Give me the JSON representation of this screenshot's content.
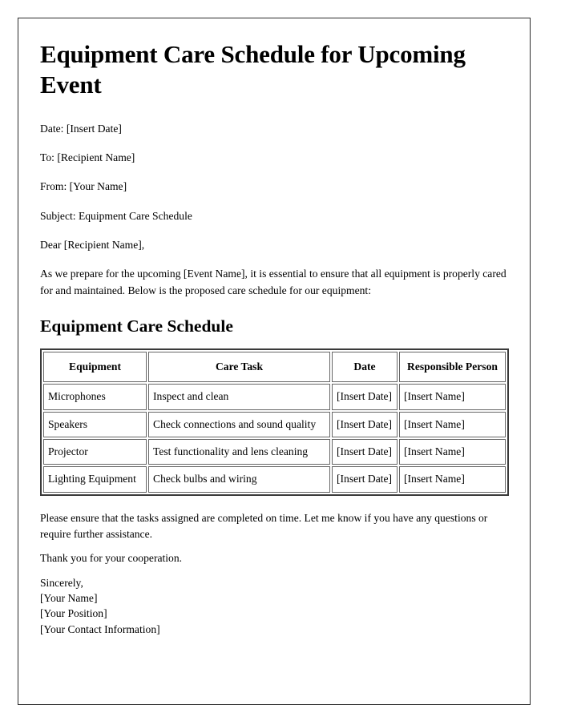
{
  "document": {
    "title": "Equipment Care Schedule for Upcoming Event",
    "meta_lines": [
      "Date: [Insert Date]",
      "To: [Recipient Name]",
      "From: [Your Name]",
      "Subject: Equipment Care Schedule",
      "Dear [Recipient Name],"
    ],
    "intro_paragraph": "As we prepare for the upcoming [Event Name], it is essential to ensure that all equipment is properly cared for and maintained. Below is the proposed care schedule for our equipment:",
    "section_heading": "Equipment Care Schedule",
    "table": {
      "headers": [
        "Equipment",
        "Care Task",
        "Date",
        "Responsible Person"
      ],
      "rows": [
        [
          "Microphones",
          "Inspect and clean",
          "[Insert Date]",
          "[Insert Name]"
        ],
        [
          "Speakers",
          "Check connections and sound quality",
          "[Insert Date]",
          "[Insert Name]"
        ],
        [
          "Projector",
          "Test functionality and lens cleaning",
          "[Insert Date]",
          "[Insert Name]"
        ],
        [
          "Lighting Equipment",
          "Check bulbs and wiring",
          "[Insert Date]",
          "[Insert Name]"
        ]
      ]
    },
    "closing_paragraph": "Please ensure that the tasks assigned are completed on time. Let me know if you have any questions or require further assistance.",
    "thanks_paragraph": "Thank you for your cooperation.",
    "signature_lines": [
      "Sincerely,",
      "[Your Name]",
      "[Your Position]",
      "[Your Contact Information]"
    ]
  }
}
